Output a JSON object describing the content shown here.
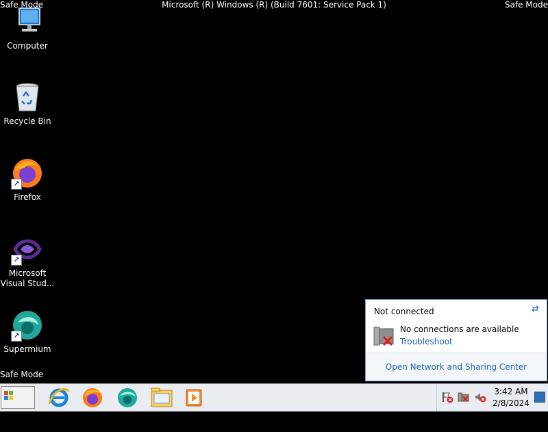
{
  "screen": {
    "safe_mode_label": "Safe Mode",
    "os_build": "Microsoft (R) Windows (R) (Build 7601: Service Pack 1)"
  },
  "desktop": {
    "icons": [
      {
        "label": "Computer",
        "icon": "computer-icon"
      },
      {
        "label": "Recycle Bin",
        "icon": "recycle-bin-icon"
      },
      {
        "label": "Firefox",
        "icon": "firefox-icon"
      },
      {
        "label": "Microsoft Visual Stud...",
        "icon": "visual-studio-icon"
      },
      {
        "label": "Supermium",
        "icon": "supermium-icon"
      }
    ]
  },
  "network_popup": {
    "title": "Not connected",
    "message": "No connections are available",
    "troubleshoot": "Troubleshoot",
    "footer_link": "Open Network and Sharing Center"
  },
  "taskbar": {
    "start_label": "Start",
    "pinned": [
      "internet-explorer-icon",
      "firefox-icon",
      "supermium-icon",
      "file-explorer-icon",
      "media-player-icon"
    ],
    "clock": {
      "time": "3:42 AM",
      "date": "2/8/2024"
    },
    "tray": [
      "action-center-error-icon",
      "network-error-icon",
      "volume-muted-icon"
    ]
  },
  "colors": {
    "desktop_bg": "#000000",
    "link": "#1e5fb3",
    "taskbar": "#e9ecf1"
  }
}
